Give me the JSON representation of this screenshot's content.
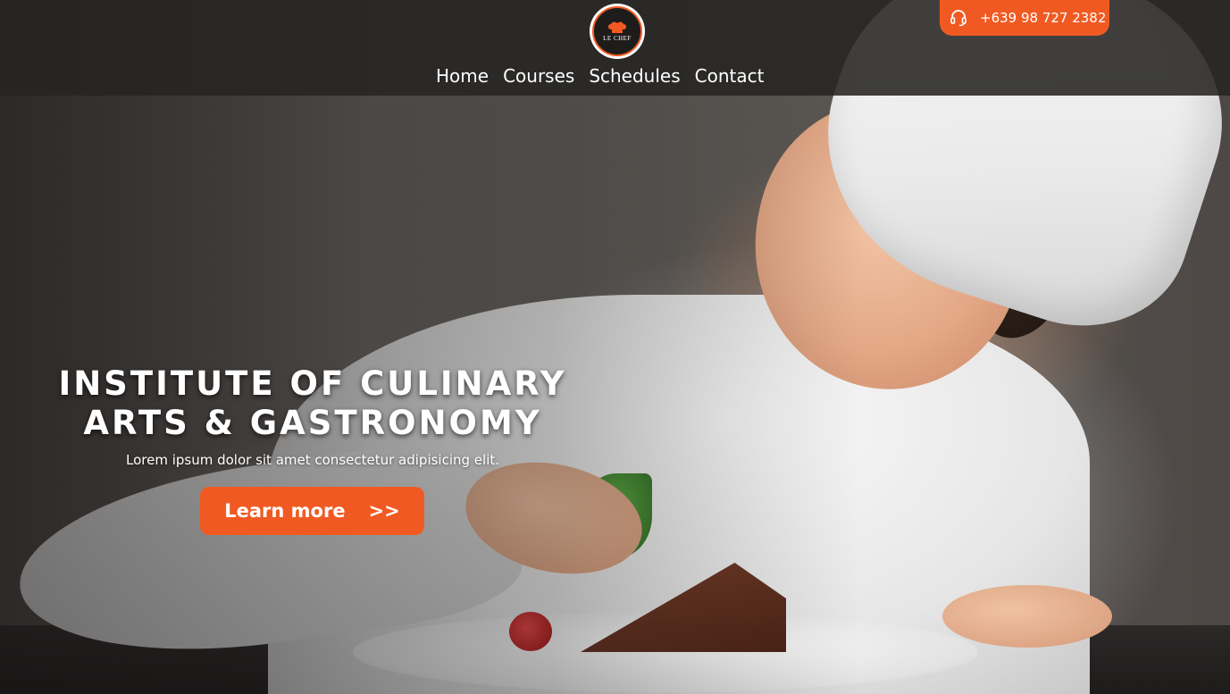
{
  "header": {
    "logo_text": "LE CHEF",
    "nav": [
      {
        "label": "Home"
      },
      {
        "label": "Courses"
      },
      {
        "label": "Schedules"
      },
      {
        "label": "Contact"
      }
    ],
    "phone": "+639 98 727 2382",
    "phone_icon": "headset-icon"
  },
  "hero": {
    "title_line1": "INSTITUTE OF CULINARY",
    "title_line2": "ARTS & GASTRONOMY",
    "subtitle": "Lorem ipsum dolor sit amet consectetur adipisicing elit.",
    "cta_label": "Learn more",
    "cta_arrow": ">>"
  },
  "colors": {
    "accent": "#f05a22",
    "header_bg": "#262423",
    "text": "#ffffff"
  }
}
